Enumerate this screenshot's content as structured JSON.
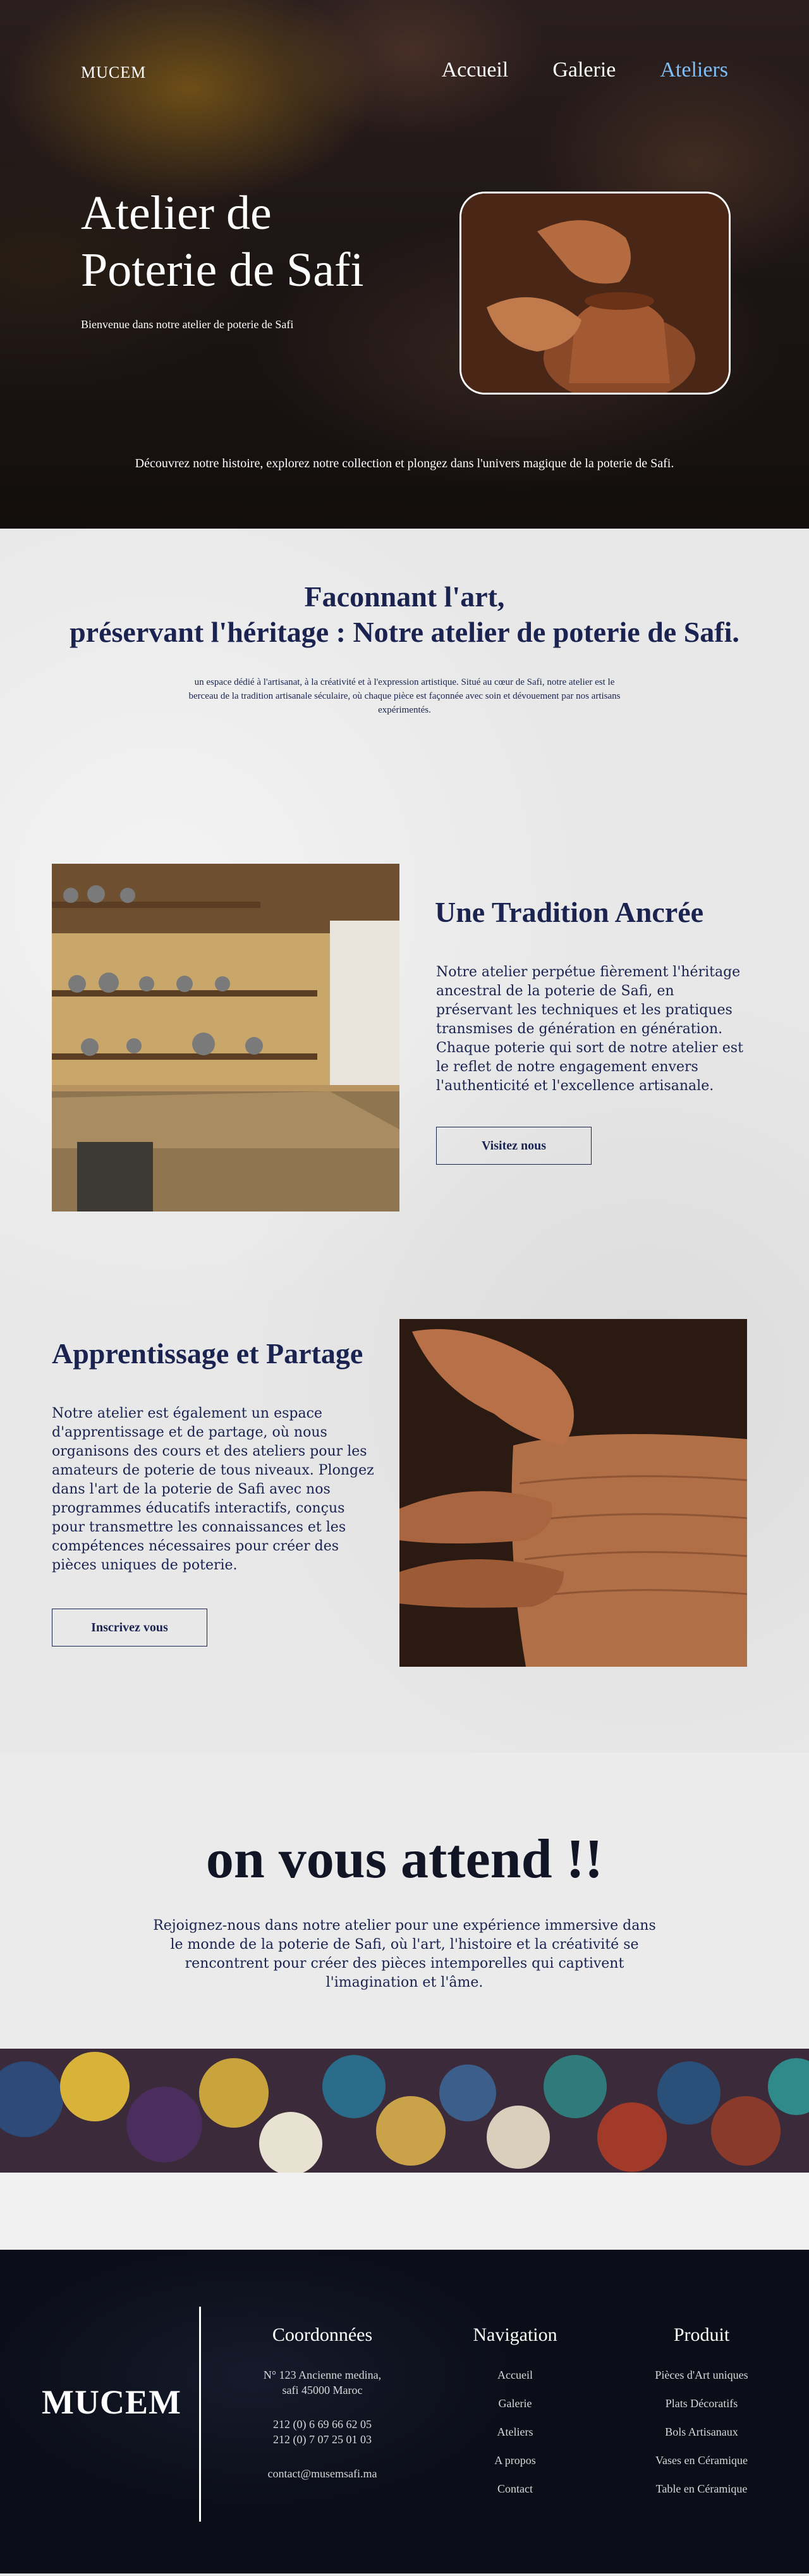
{
  "header": {
    "logo": "MUCEM",
    "nav": [
      {
        "label": "Accueil",
        "active": false
      },
      {
        "label": "Galerie",
        "active": false
      },
      {
        "label": "Ateliers",
        "active": true
      }
    ]
  },
  "hero": {
    "title_line1": "Atelier de",
    "title_line2": "Poterie de Safi",
    "welcome": "Bienvenue dans notre atelier de poterie de Safi",
    "discover": "Découvrez notre histoire, explorez notre collection et plongez dans l'univers magique de la poterie de Safi."
  },
  "intro": {
    "title_line1": "Faconnant l'art,",
    "title_line2": "préservant l'héritage : Notre atelier de poterie de Safi.",
    "text": "un espace dédié à l'artisanat, à la créativité et à l'expression artistique. Situé au cœur de Safi, notre atelier est le berceau de la tradition artisanale séculaire, où chaque pièce est façonnée avec soin et dévouement par nos artisans expérimentés."
  },
  "tradition": {
    "title": "Une Tradition Ancrée",
    "text": "Notre atelier perpétue fièrement l'héritage ancestral de la poterie de Safi, en préservant les techniques et les pratiques transmises de génération en génération. Chaque poterie qui sort de notre atelier est le reflet de notre engagement envers l'authenticité et l'excellence artisanale.",
    "button": "Visitez nous"
  },
  "apprentissage": {
    "title": "Apprentissage et Partage",
    "text": "Notre atelier est également un espace d'apprentissage et de partage, où nous organisons des cours et des ateliers pour les amateurs de poterie de tous niveaux. Plongez dans l'art de la poterie de Safi avec nos programmes éducatifs interactifs, conçus pour transmettre les connaissances et les compétences nécessaires pour créer des pièces uniques de poterie.",
    "button": "Inscrivez vous"
  },
  "cta": {
    "title": "on vous attend !!",
    "text": "Rejoignez-nous dans notre atelier pour une expérience immersive dans le monde de la poterie de Safi, où l'art, l'histoire et la créativité se rencontrent pour créer des pièces intemporelles qui captivent l'imagination et l'âme."
  },
  "footer": {
    "logo": "MUCEM",
    "coordonnees": {
      "title": "Coordonnées",
      "address1": "N° 123 Ancienne medina,",
      "address2": "safi 45000 Maroc",
      "phone1": "212 (0) 6 69 66 62 05",
      "phone2": "212 (0) 7 07 25 01 03",
      "email": "contact@musemsafi.ma"
    },
    "navigation": {
      "title": "Navigation",
      "links": [
        "Accueil",
        "Galerie",
        "Ateliers",
        "A propos",
        "Contact"
      ]
    },
    "produit": {
      "title": "Produit",
      "links": [
        "Pièces d'Art uniques",
        "Plats Décoratifs",
        "Bols Artisanaux",
        "Vases en Céramique",
        "Table en Céramique"
      ]
    }
  }
}
